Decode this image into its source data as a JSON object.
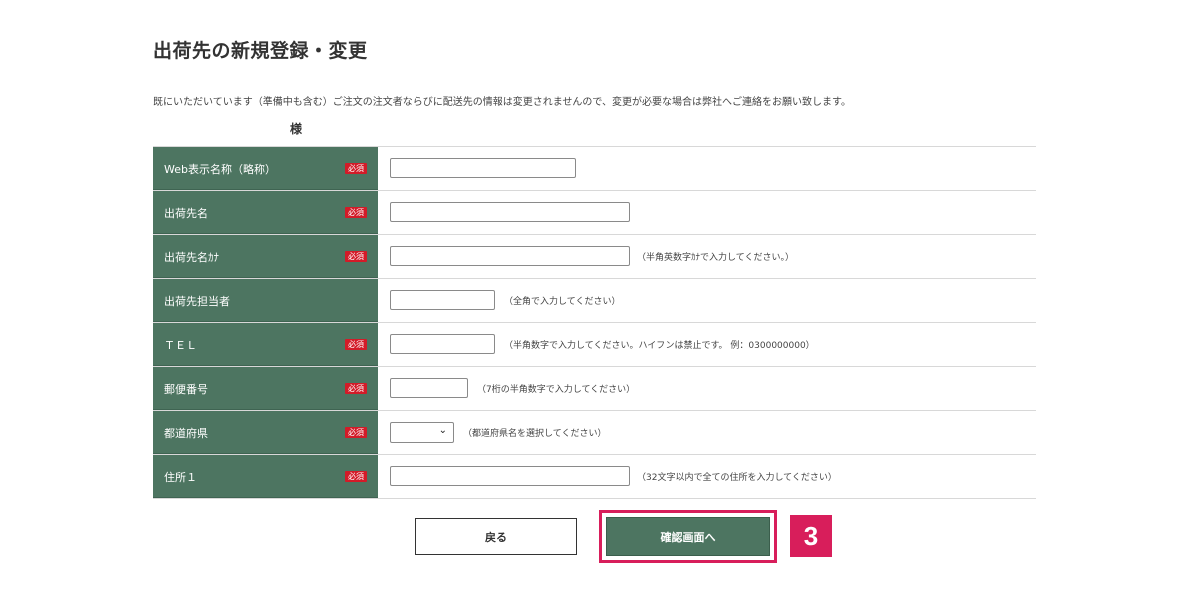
{
  "page": {
    "title": "出荷先の新規登録・変更",
    "notice": "既にいただいています（準備中も含む）ご注文の注文者ならびに配送先の情報は変更されませんので、変更が必要な場合は弊社へご連絡をお願い致します。",
    "honorific": "様"
  },
  "required_badge": "必須",
  "form": {
    "rows": [
      {
        "label": "Web表示名称（略称）",
        "required": true,
        "hint": "",
        "value": ""
      },
      {
        "label": "出荷先名",
        "required": true,
        "hint": "",
        "value": ""
      },
      {
        "label": "出荷先名ｶﾅ",
        "required": true,
        "hint": "（半角英数字ｶﾅで入力してください。）",
        "value": ""
      },
      {
        "label": "出荷先担当者",
        "required": false,
        "hint": "（全角で入力してください）",
        "value": ""
      },
      {
        "label": "ＴＥＬ",
        "required": true,
        "hint": "（半角数字で入力してください。ハイフンは禁止です。 例：0300000000）",
        "value": ""
      },
      {
        "label": "郵便番号",
        "required": true,
        "hint": "（7桁の半角数字で入力してください）",
        "value": ""
      },
      {
        "label": "都道府県",
        "required": true,
        "hint": "（都道府県名を選択してください）",
        "value": ""
      },
      {
        "label": "住所１",
        "required": true,
        "hint": "（32文字以内で全ての住所を入力してください）",
        "value": ""
      }
    ]
  },
  "buttons": {
    "back": "戻る",
    "confirm": "確認画面へ"
  },
  "step_badge": "3",
  "colors": {
    "label_bg": "#4d7561",
    "required_badge": "#d31b28",
    "highlight": "#d81e5b"
  }
}
